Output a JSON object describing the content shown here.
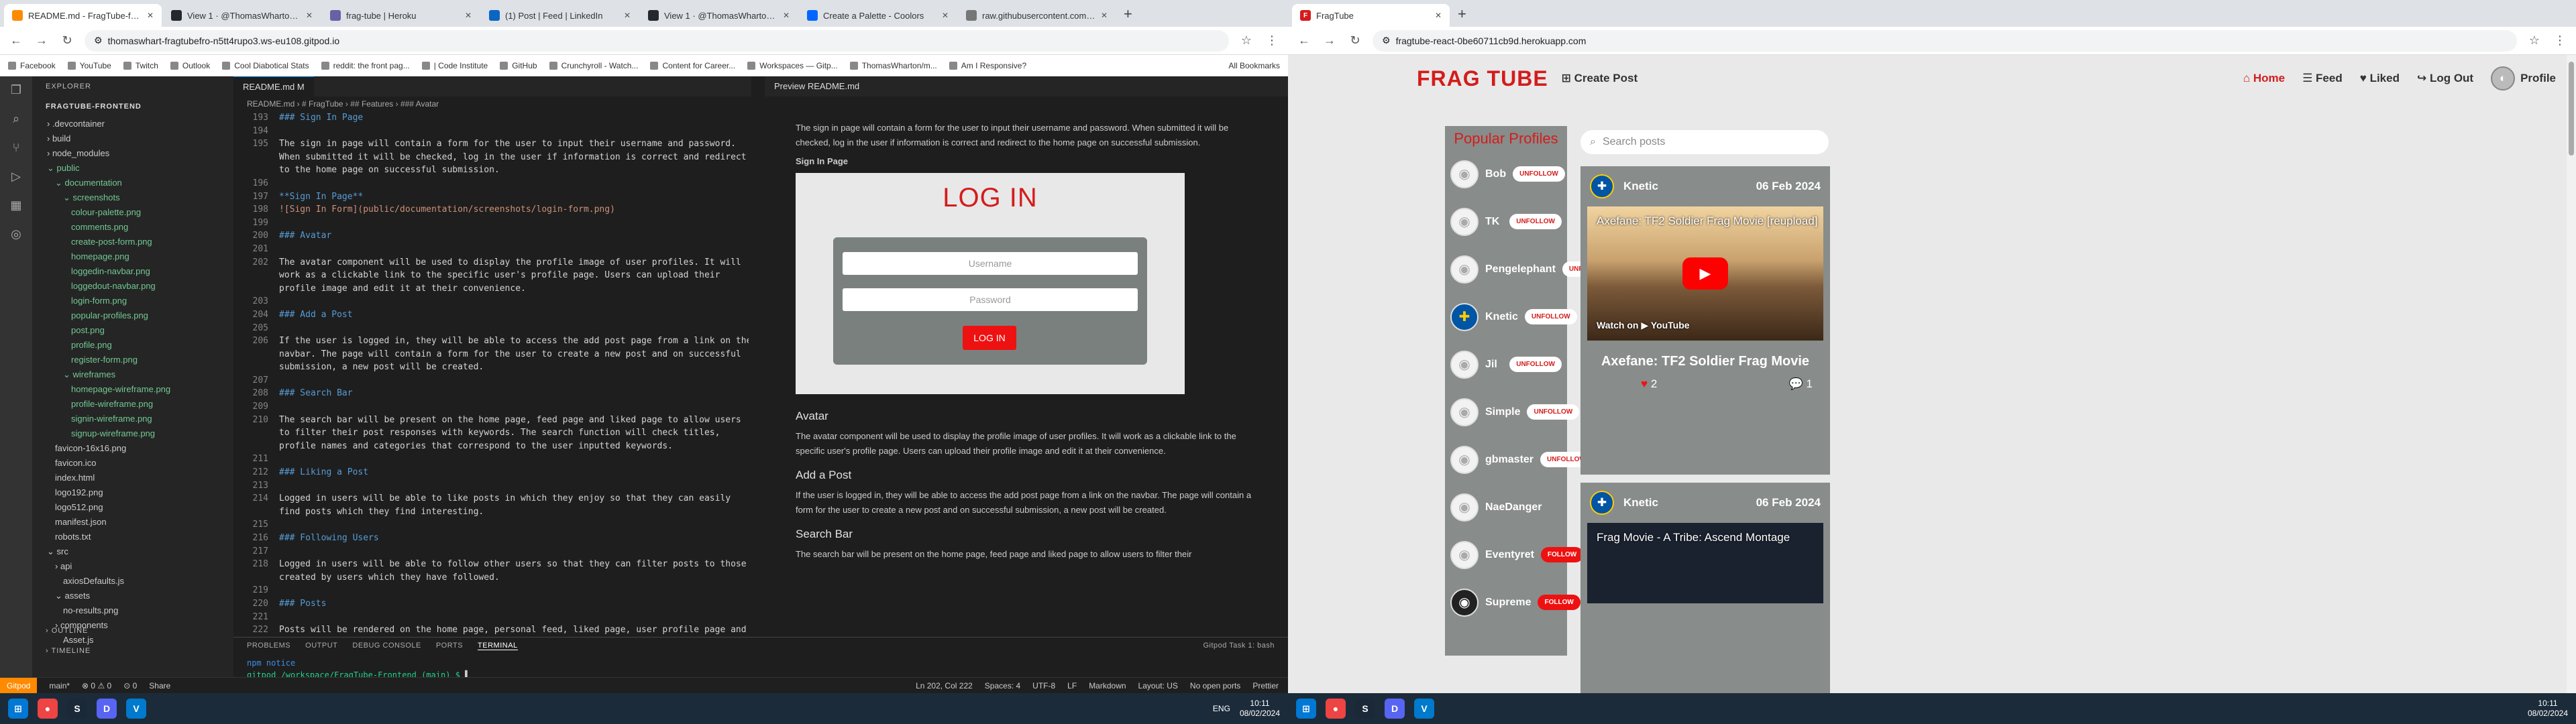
{
  "left": {
    "tabs": [
      {
        "title": "README.md - FragTube-fronte",
        "color": "#ff8a00",
        "active": true
      },
      {
        "title": "View 1 · @ThomasWharton's h",
        "color": "#24292e"
      },
      {
        "title": "frag-tube | Heroku",
        "color": "#6762a6"
      },
      {
        "title": "(1) Post | Feed | LinkedIn",
        "color": "#0a66c2"
      },
      {
        "title": "View 1 · @ThomasWharton's h",
        "color": "#24292e"
      },
      {
        "title": "Create a Palette - Coolors",
        "color": "#0066ff"
      },
      {
        "title": "raw.githubusercontent.com/Th",
        "color": "#777"
      }
    ],
    "url": "thomaswhart-fragtubefro-n5tt4rupo3.ws-eu108.gitpod.io",
    "bookmarks": [
      "Facebook",
      "YouTube",
      "Twitch",
      "Outlook",
      "Cool Diabotical Stats",
      "reddit: the front pag...",
      "| Code Institute",
      "GitHub",
      "Crunchyroll - Watch...",
      "Content for Career...",
      "Workspaces — Gitp...",
      "ThomasWharton/m...",
      "Am I Responsive?"
    ],
    "all_bookmarks": "All Bookmarks",
    "explorer": {
      "title": "EXPLORER",
      "root": "FRAGTUBE-FRONTEND",
      "items": [
        {
          "t": "› .devcontainer",
          "d": 1,
          "c": "f"
        },
        {
          "t": "› build",
          "d": 1,
          "c": "f"
        },
        {
          "t": "› node_modules",
          "d": 1,
          "c": "f"
        },
        {
          "t": "⌄ public",
          "d": 1,
          "c": "g"
        },
        {
          "t": "⌄ documentation",
          "d": 2,
          "c": "g"
        },
        {
          "t": "⌄ screenshots",
          "d": 3,
          "c": "g"
        },
        {
          "t": "colour-palette.png",
          "d": 4,
          "c": "g"
        },
        {
          "t": "comments.png",
          "d": 4,
          "c": "g"
        },
        {
          "t": "create-post-form.png",
          "d": 4,
          "c": "g"
        },
        {
          "t": "homepage.png",
          "d": 4,
          "c": "g"
        },
        {
          "t": "loggedin-navbar.png",
          "d": 4,
          "c": "g"
        },
        {
          "t": "loggedout-navbar.png",
          "d": 4,
          "c": "g"
        },
        {
          "t": "login-form.png",
          "d": 4,
          "c": "g"
        },
        {
          "t": "popular-profiles.png",
          "d": 4,
          "c": "g"
        },
        {
          "t": "post.png",
          "d": 4,
          "c": "g"
        },
        {
          "t": "profile.png",
          "d": 4,
          "c": "g"
        },
        {
          "t": "register-form.png",
          "d": 4,
          "c": "g"
        },
        {
          "t": "⌄ wireframes",
          "d": 3,
          "c": "g"
        },
        {
          "t": "homepage-wireframe.png",
          "d": 4,
          "c": "g"
        },
        {
          "t": "profile-wireframe.png",
          "d": 4,
          "c": "g"
        },
        {
          "t": "signin-wireframe.png",
          "d": 4,
          "c": "g"
        },
        {
          "t": "signup-wireframe.png",
          "d": 4,
          "c": "g"
        },
        {
          "t": "favicon-16x16.png",
          "d": 2,
          "c": "f"
        },
        {
          "t": "favicon.ico",
          "d": 2,
          "c": "f"
        },
        {
          "t": "index.html",
          "d": 2,
          "c": "f"
        },
        {
          "t": "logo192.png",
          "d": 2,
          "c": "f"
        },
        {
          "t": "logo512.png",
          "d": 2,
          "c": "f"
        },
        {
          "t": "manifest.json",
          "d": 2,
          "c": "f"
        },
        {
          "t": "robots.txt",
          "d": 2,
          "c": "f"
        },
        {
          "t": "⌄ src",
          "d": 1,
          "c": "f"
        },
        {
          "t": "› api",
          "d": 2,
          "c": "f"
        },
        {
          "t": "axiosDefaults.js",
          "d": 3,
          "c": "f"
        },
        {
          "t": "⌄ assets",
          "d": 2,
          "c": "f"
        },
        {
          "t": "no-results.png",
          "d": 3,
          "c": "f"
        },
        {
          "t": "› components",
          "d": 2,
          "c": "f"
        },
        {
          "t": "Asset.js",
          "d": 3,
          "c": "f"
        }
      ],
      "outline": "› OUTLINE",
      "timeline": "› TIMELINE"
    },
    "editor_tab": "README.md  M",
    "breadcrumb": "README.md › # FragTube › ## Features › ### Avatar",
    "line_numbers": [
      "193",
      "194",
      "195",
      "",
      "",
      "196",
      "197",
      "198",
      "199",
      "200",
      "201",
      "202",
      "",
      "",
      "203",
      "204",
      "205",
      "206",
      "",
      "",
      "207",
      "208",
      "209",
      "210",
      "",
      "",
      "211",
      "212",
      "213",
      "214",
      "",
      "215",
      "216",
      "217",
      "218",
      "",
      "219",
      "220",
      "221",
      "222"
    ],
    "code_lines": [
      {
        "t": "### Sign In Page",
        "k": "h"
      },
      {
        "t": "",
        "k": ""
      },
      {
        "t": "The sign in page will contain a form for the user to input their username and password.",
        "k": ""
      },
      {
        "t": "When submitted it will be checked, log in the user if information is correct and redirect",
        "k": ""
      },
      {
        "t": "to the home page on successful submission.",
        "k": ""
      },
      {
        "t": "",
        "k": ""
      },
      {
        "t": "**Sign In Page**",
        "k": "h"
      },
      {
        "t": "![Sign In Form](public/documentation/screenshots/login-form.png)",
        "k": "lk"
      },
      {
        "t": "",
        "k": ""
      },
      {
        "t": "### Avatar",
        "k": "h"
      },
      {
        "t": "",
        "k": ""
      },
      {
        "t": "The avatar component will be used to display the profile image of user profiles. It will",
        "k": ""
      },
      {
        "t": "work as a clickable link to the specific user's profile page. Users can upload their",
        "k": ""
      },
      {
        "t": "profile image and edit it at their convenience.",
        "k": ""
      },
      {
        "t": "",
        "k": ""
      },
      {
        "t": "### Add a Post",
        "k": "h"
      },
      {
        "t": "",
        "k": ""
      },
      {
        "t": "If the user is logged in, they will be able to access the add post page from a link on the",
        "k": ""
      },
      {
        "t": "navbar. The page will contain a form for the user to create a new post and on successful",
        "k": ""
      },
      {
        "t": "submission, a new post will be created.",
        "k": ""
      },
      {
        "t": "",
        "k": ""
      },
      {
        "t": "### Search Bar",
        "k": "h"
      },
      {
        "t": "",
        "k": ""
      },
      {
        "t": "The search bar will be present on the home page, feed page and liked page to allow users",
        "k": ""
      },
      {
        "t": "to filter their post responses with keywords. The search function will check titles,",
        "k": ""
      },
      {
        "t": "profile names and categories that correspond to the user inputted keywords.",
        "k": ""
      },
      {
        "t": "",
        "k": ""
      },
      {
        "t": "### Liking a Post",
        "k": "h"
      },
      {
        "t": "",
        "k": ""
      },
      {
        "t": "Logged in users will be able to like posts in which they enjoy so that they can easily",
        "k": ""
      },
      {
        "t": "find posts which they find interesting.",
        "k": ""
      },
      {
        "t": "",
        "k": ""
      },
      {
        "t": "### Following Users",
        "k": "h"
      },
      {
        "t": "",
        "k": ""
      },
      {
        "t": "Logged in users will be able to follow other users so that they can filter posts to those",
        "k": ""
      },
      {
        "t": "created by users which they have followed.",
        "k": ""
      },
      {
        "t": "",
        "k": ""
      },
      {
        "t": "### Posts",
        "k": "h"
      },
      {
        "t": "",
        "k": ""
      },
      {
        "t": "Posts will be rendered on the home page, personal feed, liked page, user profile page and",
        "k": ""
      }
    ],
    "preview": {
      "tab": "Preview README.md",
      "intro": "The sign in page will contain a form for the user to input their username and password. When submitted it will be checked, log in the user if information is correct and redirect to the home page on successful submission.",
      "signin_label": "Sign In Page",
      "login_title": "LOG IN",
      "username_ph": "Username",
      "password_ph": "Password",
      "login_btn": "LOG IN",
      "avatar_h": "Avatar",
      "avatar_p": "The avatar component will be used to display the profile image of user profiles. It will work as a clickable link to the specific user's profile page. Users can upload their profile image and edit it at their convenience.",
      "addpost_h": "Add a Post",
      "addpost_p": "If the user is logged in, they will be able to access the add post page from a link on the navbar. The page will contain a form for the user to create a new post and on successful submission, a new post will be created.",
      "search_h": "Search Bar",
      "search_p": "The search bar will be present on the home page, feed page and liked page to allow users to filter their"
    },
    "panel": {
      "tabs": [
        "PROBLEMS",
        "OUTPUT",
        "DEBUG CONSOLE",
        "PORTS",
        "TERMINAL"
      ],
      "task": "Gitpod Task 1: bash",
      "term1": "npm notice",
      "term2": "gitpod /workspace/FragTube-Frontend (main) $"
    },
    "status": {
      "gitpod": "Gitpod",
      "branch": "main*",
      "errors": "⊗ 0  ⚠ 0",
      "ports": "⊙ 0",
      "share": "Share",
      "pos": "Ln 202, Col 222",
      "spaces": "Spaces: 4",
      "enc": "UTF-8",
      "eol": "LF",
      "lang": "Markdown",
      "layout": "Layout: US",
      "noports": "No open ports",
      "prettier": "Prettier"
    },
    "tray": {
      "lang": "ENG",
      "time": "10:11",
      "date": "08/02/2024"
    }
  },
  "right": {
    "tab": "FragTube",
    "url": "fragtube-react-0be60711cb9d.herokuapp.com",
    "app": {
      "logo": "FRAG TUBE",
      "create": "Create Post",
      "nav": [
        "Home",
        "Feed",
        "Liked",
        "Log Out"
      ],
      "profile": "Profile",
      "popular_title": "Popular Profiles",
      "profiles": [
        {
          "name": "Bob",
          "btn": "UNFOLLOW"
        },
        {
          "name": "TK",
          "btn": "UNFOLLOW"
        },
        {
          "name": "Pengelephant",
          "btn": "UNFOLLOW"
        },
        {
          "name": "Knetic",
          "btn": "UNFOLLOW"
        },
        {
          "name": "Jil",
          "btn": "UNFOLLOW"
        },
        {
          "name": "Simple",
          "btn": "UNFOLLOW"
        },
        {
          "name": "gbmaster",
          "btn": "UNFOLLOW"
        },
        {
          "name": "NaeDanger",
          "btn": ""
        },
        {
          "name": "Eventyret",
          "btn": "FOLLOW"
        },
        {
          "name": "Supreme",
          "btn": "FOLLOW"
        }
      ],
      "search_ph": "Search posts",
      "post1": {
        "author": "Knetic",
        "date": "06 Feb 2024",
        "video_title": "Axefane: TF2 Soldier Frag Movie [reupload]",
        "watch": "Watch on ▶ YouTube",
        "title": "Axefane: TF2 Soldier Frag Movie",
        "likes": "2",
        "comments": "1"
      },
      "post2": {
        "author": "Knetic",
        "date": "06 Feb 2024",
        "video_title": "Frag Movie - A Tribe: Ascend Montage"
      }
    },
    "tray": {
      "time": "10:11",
      "date": "08/02/2024"
    }
  }
}
